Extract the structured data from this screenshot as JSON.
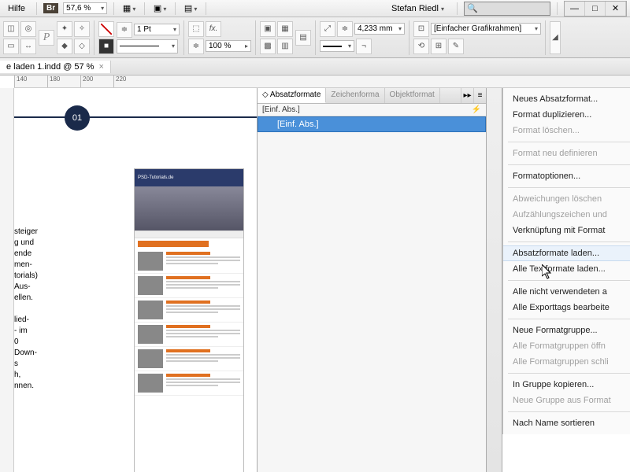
{
  "menubar": {
    "help": "Hilfe",
    "br": "Br",
    "zoom": "57,6 %",
    "user": "Stefan Riedl"
  },
  "toolbar": {
    "stroke_weight": "1 Pt",
    "opacity": "100 %",
    "frame_size": "4,233 mm",
    "frame_type": "[Einfacher Grafikrahmen]"
  },
  "doctab": {
    "title": "e laden 1.indd @ 57 %",
    "close": "×"
  },
  "ruler": {
    "marks": [
      "140",
      "180",
      "200",
      "220"
    ]
  },
  "canvas": {
    "badge": "01",
    "text_lines": [
      "steiger",
      "g und",
      "ende",
      "men-",
      "torials)",
      "Aus-",
      "ellen.",
      "",
      "lied-",
      "- im",
      "0",
      "Down-",
      "s",
      "h,",
      "nnen."
    ],
    "webthumb_title": "PSD-Tutorials.de"
  },
  "panel": {
    "tabs": {
      "t1": "Absatzformate",
      "t2": "Zeichenforma",
      "t3": "Objektformat"
    },
    "crumb": "[Einf. Abs.]",
    "selected": "[Einf. Abs.]"
  },
  "context_menu": {
    "items": [
      {
        "label": "Neues Absatzformat...",
        "enabled": true
      },
      {
        "label": "Format duplizieren...",
        "enabled": true
      },
      {
        "label": "Format löschen...",
        "enabled": false
      },
      {
        "sep": true
      },
      {
        "label": "Format neu definieren",
        "enabled": false
      },
      {
        "sep": true
      },
      {
        "label": "Formatoptionen...",
        "enabled": true
      },
      {
        "sep": true
      },
      {
        "label": "Abweichungen löschen",
        "enabled": false
      },
      {
        "label": "Aufzählungszeichen und",
        "enabled": false
      },
      {
        "label": "Verknüpfung mit Format",
        "enabled": true
      },
      {
        "sep": true
      },
      {
        "label": "Absatzformate laden...",
        "enabled": true,
        "hover": true
      },
      {
        "label": "Alle Textformate laden...",
        "enabled": true
      },
      {
        "sep": true
      },
      {
        "label": "Alle nicht verwendeten a",
        "enabled": true
      },
      {
        "label": "Alle Exporttags bearbeite",
        "enabled": true
      },
      {
        "sep": true
      },
      {
        "label": "Neue Formatgruppe...",
        "enabled": true
      },
      {
        "label": "Alle Formatgruppen öffn",
        "enabled": false
      },
      {
        "label": "Alle Formatgruppen schli",
        "enabled": false
      },
      {
        "sep": true
      },
      {
        "label": "In Gruppe kopieren...",
        "enabled": true
      },
      {
        "label": "Neue Gruppe aus Format",
        "enabled": false
      },
      {
        "sep": true
      },
      {
        "label": "Nach Name sortieren",
        "enabled": true
      }
    ]
  }
}
